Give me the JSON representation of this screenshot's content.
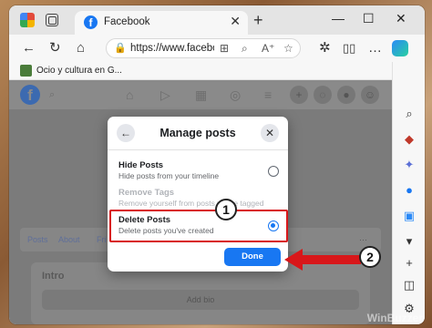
{
  "browser": {
    "tab_title": "Facebook",
    "tab_close": "✕",
    "new_tab": "+",
    "win_min": "—",
    "win_max": "☐",
    "win_close": "✕",
    "url": "https://www.facebo",
    "favorites": [
      {
        "label": "Ocio y cultura en G..."
      }
    ]
  },
  "icons": {
    "back": "←",
    "reload": "↻",
    "home": "⌂",
    "lock": "🔒",
    "apps": "⊞",
    "zoom": "⌕",
    "read_aloud": "A⁺",
    "favorite": "☆",
    "extensions": "✲",
    "more": "…"
  },
  "facebook": {
    "logo": "f",
    "profile_tabs": [
      "Posts",
      "About",
      "Fri"
    ],
    "more_tabs": "···",
    "intro_heading": "Intro",
    "add_bio": "Add bio"
  },
  "modal": {
    "title": "Manage posts",
    "back_icon": "←",
    "close_icon": "✕",
    "options": [
      {
        "title": "Hide Posts",
        "desc": "Hide posts from your timeline",
        "selected": false,
        "disabled": false
      },
      {
        "title": "Remove Tags",
        "desc": "Remove yourself from posts you're tagged in",
        "selected": false,
        "disabled": true
      },
      {
        "title": "Delete Posts",
        "desc": "Delete posts you've created",
        "selected": true,
        "disabled": false
      }
    ],
    "done_label": "Done"
  },
  "annotations": {
    "badge_1": "1",
    "badge_2": "2",
    "accent": "#d8171a"
  },
  "watermark": "WinBuzzer"
}
